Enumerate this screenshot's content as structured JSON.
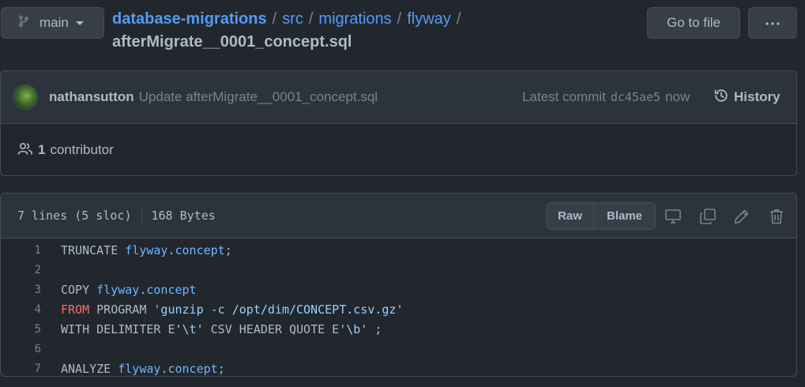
{
  "branch": {
    "icon": "git-branch-icon",
    "label": "main"
  },
  "breadcrumb": {
    "repo": "database-migrations",
    "sep": "/",
    "dirs": [
      "src",
      "migrations",
      "flyway"
    ],
    "file": "afterMigrate__0001_concept.sql"
  },
  "actions": {
    "goto_file": "Go to file",
    "more": "···"
  },
  "commit": {
    "author": "nathansutton",
    "message": "Update afterMigrate__0001_concept.sql",
    "latest_label": "Latest commit",
    "sha": "dc45ae5",
    "time": "now",
    "history_label": "History"
  },
  "contributors": {
    "count": "1",
    "label": "contributor"
  },
  "file": {
    "lines_info": "7 lines (5 sloc)",
    "size": "168 Bytes",
    "raw_label": "Raw",
    "blame_label": "Blame"
  },
  "code_lines": [
    {
      "n": "1",
      "tokens": [
        [
          "plain",
          "TRUNCATE "
        ],
        [
          "id",
          "flyway"
        ],
        [
          "plain",
          "."
        ],
        [
          "id",
          "concept"
        ],
        [
          "plain",
          ";"
        ]
      ]
    },
    {
      "n": "2",
      "tokens": []
    },
    {
      "n": "3",
      "tokens": [
        [
          "plain",
          "COPY "
        ],
        [
          "id",
          "flyway"
        ],
        [
          "plain",
          "."
        ],
        [
          "id",
          "concept"
        ]
      ]
    },
    {
      "n": "4",
      "tokens": [
        [
          "kw",
          "FROM"
        ],
        [
          "plain",
          " PROGRAM "
        ],
        [
          "str",
          "'gunzip -c /opt/dim/CONCEPT.csv.gz'"
        ]
      ]
    },
    {
      "n": "5",
      "tokens": [
        [
          "plain",
          "WITH DELIMITER E"
        ],
        [
          "str",
          "'\\t'"
        ],
        [
          "plain",
          " CSV HEADER QUOTE E"
        ],
        [
          "str",
          "'\\b'"
        ],
        [
          "plain",
          " ;"
        ]
      ]
    },
    {
      "n": "6",
      "tokens": []
    },
    {
      "n": "7",
      "tokens": [
        [
          "plain",
          "ANALYZE "
        ],
        [
          "id",
          "flyway"
        ],
        [
          "plain",
          "."
        ],
        [
          "id",
          "concept"
        ],
        [
          "plain",
          ";"
        ]
      ]
    }
  ]
}
